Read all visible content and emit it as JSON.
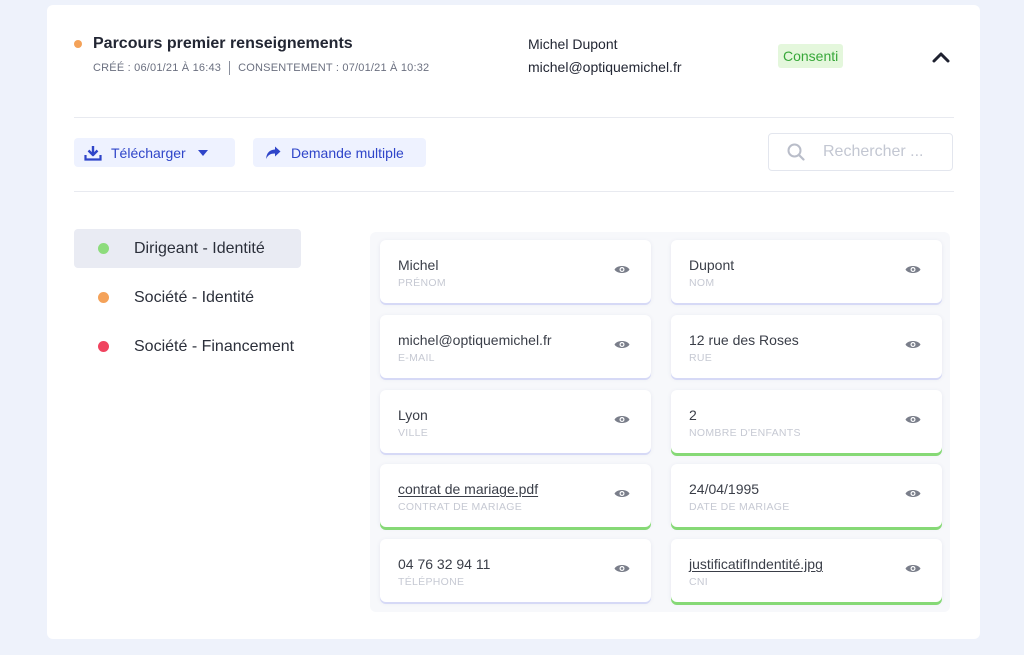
{
  "header": {
    "title": "Parcours premier renseignements",
    "created": "CRÉÉ : 06/01/21 À 16:43",
    "consent": "CONSENTEMENT : 07/01/21 À 10:32",
    "user_name": "Michel Dupont",
    "user_email": "michel@optiquemichel.fr",
    "status": "Consenti",
    "status_dot_color": "#f4a259",
    "collapse_icon": "chevron-up-icon"
  },
  "toolbar": {
    "download_label": "Télécharger",
    "download_icon": "download-icon",
    "multi_label": "Demande multiple",
    "multi_icon": "share-arrow-icon",
    "search_placeholder": "Rechercher ..."
  },
  "categories": [
    {
      "label": "Dirigeant - Identité",
      "color": "#8ddc7c",
      "active": true
    },
    {
      "label": "Société - Identité",
      "color": "#f4a259",
      "active": false
    },
    {
      "label": "Société - Financement",
      "color": "#f0445f",
      "active": false
    }
  ],
  "fields": [
    {
      "value": "Michel",
      "label": "PRÉNOM",
      "link": false,
      "completed": false
    },
    {
      "value": "Dupont",
      "label": "NOM",
      "link": false,
      "completed": false
    },
    {
      "value": "michel@optiquemichel.fr",
      "label": "E-MAIL",
      "link": false,
      "completed": false
    },
    {
      "value": "12 rue des Roses",
      "label": "RUE",
      "link": false,
      "completed": false
    },
    {
      "value": "Lyon",
      "label": "VILLE",
      "link": false,
      "completed": false
    },
    {
      "value": "2",
      "label": "NOMBRE D'ENFANTS",
      "link": false,
      "completed": true
    },
    {
      "value": "contrat de mariage.pdf",
      "label": "CONTRAT DE MARIAGE",
      "link": true,
      "completed": true
    },
    {
      "value": "24/04/1995",
      "label": "DATE DE MARIAGE",
      "link": false,
      "completed": true
    },
    {
      "value": "04 76 32 94 11",
      "label": "TÉLÉPHONE",
      "link": false,
      "completed": false
    },
    {
      "value": "justificatifIndentité.jpg",
      "label": "CNI",
      "link": true,
      "completed": true
    }
  ],
  "colors": {
    "accent": "#2f45c9",
    "completed": "#86d976",
    "pending": "#d6d9f6",
    "badge_bg": "#e4f7dc",
    "badge_text": "#38a83a"
  }
}
